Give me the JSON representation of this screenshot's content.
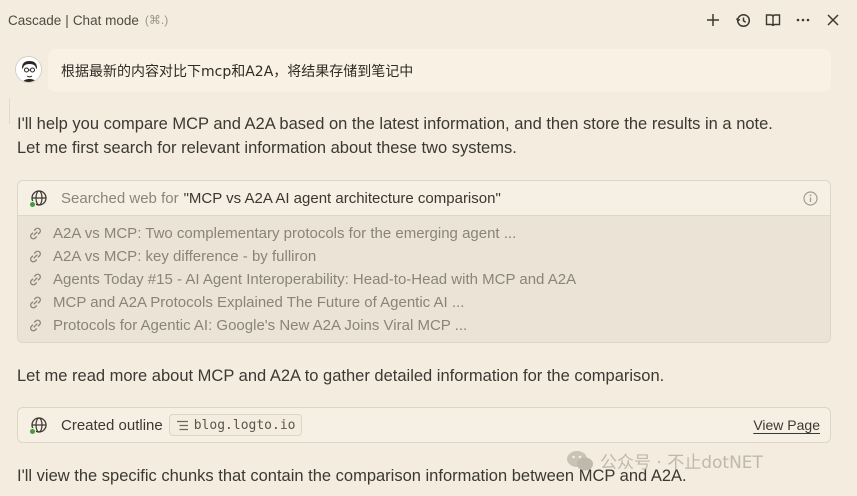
{
  "header": {
    "title": "Cascade",
    "separator": "|",
    "mode": "Chat mode",
    "shortcut": "(⌘.)",
    "actions": [
      "plus-icon",
      "history-icon",
      "book-icon",
      "more-icon",
      "close-icon"
    ]
  },
  "user_message": {
    "text": "根据最新的内容对比下mcp和A2A，将结果存储到笔记中"
  },
  "assistant": {
    "intro_line1": "I'll help you compare MCP and A2A based on the latest information, and then store the results in a note.",
    "intro_line2": "Let me first search for relevant information about these two systems.",
    "search": {
      "prefix": "Searched web for",
      "query": "\"MCP vs A2A AI agent architecture comparison\"",
      "results": [
        "A2A vs MCP: Two complementary protocols for the emerging agent ...",
        "A2A vs MCP: key difference - by fulliron",
        "Agents Today #15 - AI Agent Interoperability: Head-to-Head with MCP and A2A",
        "MCP and A2A Protocols Explained The Future of Agentic AI ...",
        "Protocols for Agentic AI: Google's New A2A Joins Viral MCP ..."
      ]
    },
    "read_more": "Let me read more about MCP and A2A to gather detailed information for the comparison.",
    "outline": {
      "label": "Created outline",
      "chip": "blog.logto.io",
      "view_page": "View Page"
    },
    "view_chunks": "I'll view the specific chunks that contain the comparison information between MCP and A2A."
  },
  "watermark": "公众号 · 不止dotNET",
  "colors": {
    "background": "#f3ecdf",
    "status_green": "#3f9c40",
    "link_gray": "#8a8479"
  }
}
